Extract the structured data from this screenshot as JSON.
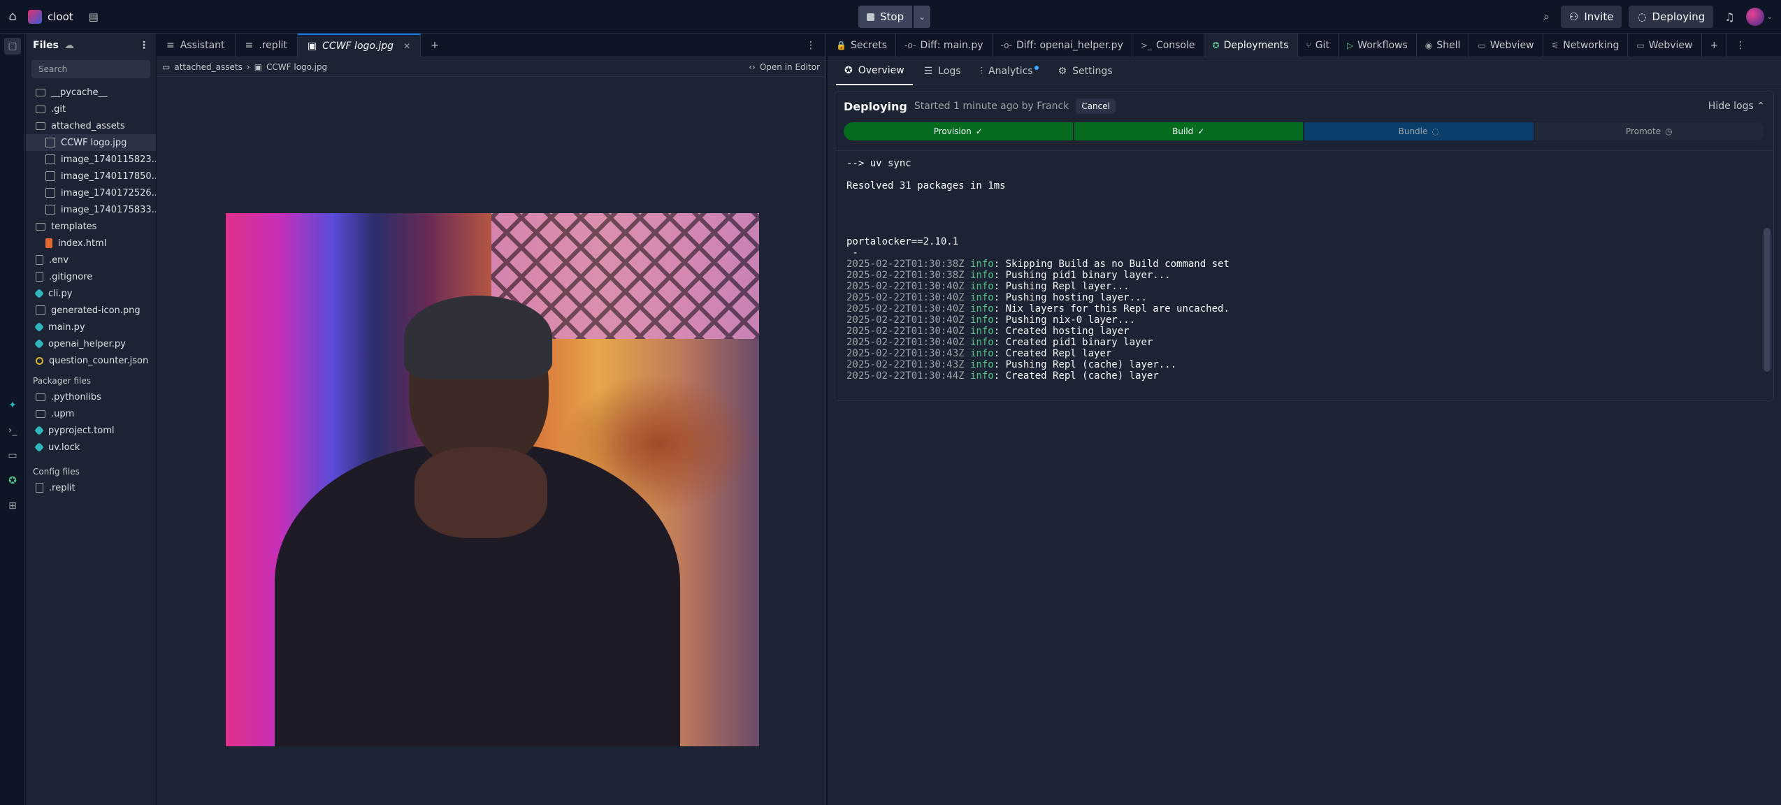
{
  "topbar": {
    "project": "cloot",
    "stop_label": "Stop",
    "invite_label": "Invite",
    "deploying_label": "Deploying"
  },
  "files": {
    "title": "Files",
    "search_placeholder": "Search",
    "tree": [
      {
        "name": "__pycache__",
        "type": "folder",
        "depth": 0
      },
      {
        "name": ".git",
        "type": "folder",
        "depth": 0
      },
      {
        "name": "attached_assets",
        "type": "folder",
        "depth": 0
      },
      {
        "name": "CCWF logo.jpg",
        "type": "img",
        "depth": 1,
        "selected": true
      },
      {
        "name": "image_1740115823...",
        "type": "img",
        "depth": 1
      },
      {
        "name": "image_1740117850...",
        "type": "img",
        "depth": 1
      },
      {
        "name": "image_1740172526...",
        "type": "img",
        "depth": 1
      },
      {
        "name": "image_1740175833...",
        "type": "img",
        "depth": 1
      },
      {
        "name": "templates",
        "type": "folder",
        "depth": 0
      },
      {
        "name": "index.html",
        "type": "html",
        "depth": 1
      },
      {
        "name": ".env",
        "type": "file",
        "depth": 0
      },
      {
        "name": ".gitignore",
        "type": "file",
        "depth": 0
      },
      {
        "name": "cli.py",
        "type": "py",
        "depth": 0
      },
      {
        "name": "generated-icon.png",
        "type": "img",
        "depth": 0
      },
      {
        "name": "main.py",
        "type": "py",
        "depth": 0
      },
      {
        "name": "openai_helper.py",
        "type": "py",
        "depth": 0
      },
      {
        "name": "question_counter.json",
        "type": "json",
        "depth": 0
      }
    ],
    "packager_label": "Packager files",
    "packager": [
      {
        "name": ".pythonlibs",
        "type": "folder"
      },
      {
        "name": ".upm",
        "type": "folder"
      },
      {
        "name": "pyproject.toml",
        "type": "toml"
      },
      {
        "name": "uv.lock",
        "type": "toml"
      }
    ],
    "config_label": "Config files",
    "config": [
      {
        "name": ".replit",
        "type": "file"
      }
    ]
  },
  "editor": {
    "tabs": [
      {
        "label": "Assistant",
        "icon": "assistant-icon"
      },
      {
        "label": ".replit",
        "icon": "replit-icon"
      },
      {
        "label": "CCWF logo.jpg",
        "icon": "image-icon",
        "active": true
      }
    ],
    "breadcrumb": [
      "attached_assets",
      "CCWF logo.jpg"
    ],
    "open_in_editor": "Open in Editor"
  },
  "right": {
    "tabs": [
      {
        "label": "Secrets",
        "icon": "lock-icon"
      },
      {
        "label": "Diff: main.py",
        "icon": "diff-icon"
      },
      {
        "label": "Diff: openai_helper.py",
        "icon": "diff-icon"
      },
      {
        "label": "Console",
        "icon": "console-icon"
      },
      {
        "label": "Deployments",
        "icon": "deploy-icon",
        "active": true
      },
      {
        "label": "Git",
        "icon": "git-icon"
      },
      {
        "label": "Workflows",
        "icon": "play-icon"
      },
      {
        "label": "Shell",
        "icon": "shell-icon"
      },
      {
        "label": "Webview",
        "icon": "monitor-icon"
      },
      {
        "label": "Networking",
        "icon": "network-icon"
      },
      {
        "label": "Webview",
        "icon": "monitor-icon"
      }
    ],
    "subtabs": [
      "Overview",
      "Logs",
      "Analytics",
      "Settings"
    ],
    "deploy": {
      "title": "Deploying",
      "subtitle": "Started 1 minute ago by Franck",
      "cancel": "Cancel",
      "hide_logs": "Hide logs",
      "steps": [
        {
          "label": "Provision",
          "state": "done"
        },
        {
          "label": "Build",
          "state": "done"
        },
        {
          "label": "Bundle",
          "state": "running"
        },
        {
          "label": "Promote",
          "state": "pending"
        }
      ],
      "log_lines": [
        {
          "text": "--> uv sync"
        },
        {
          "text": ""
        },
        {
          "text": "Resolved 31 packages in 1ms"
        },
        {
          "text": ""
        },
        {
          "text": ""
        },
        {
          "text": ""
        },
        {
          "text": ""
        },
        {
          "text": "portalocker==2.10.1"
        },
        {
          "text": " -"
        },
        {
          "ts": "2025-02-22T01:30:38Z",
          "lvl": "info",
          "msg": ": Skipping Build as no Build command set"
        },
        {
          "ts": "2025-02-22T01:30:38Z",
          "lvl": "info",
          "msg": ": Pushing pid1 binary layer..."
        },
        {
          "ts": "2025-02-22T01:30:40Z",
          "lvl": "info",
          "msg": ": Pushing Repl layer..."
        },
        {
          "ts": "2025-02-22T01:30:40Z",
          "lvl": "info",
          "msg": ": Pushing hosting layer..."
        },
        {
          "ts": "2025-02-22T01:30:40Z",
          "lvl": "info",
          "msg": ": Nix layers for this Repl are uncached."
        },
        {
          "ts": "2025-02-22T01:30:40Z",
          "lvl": "info",
          "msg": ": Pushing nix-0 layer..."
        },
        {
          "ts": "2025-02-22T01:30:40Z",
          "lvl": "info",
          "msg": ": Created hosting layer"
        },
        {
          "ts": "2025-02-22T01:30:40Z",
          "lvl": "info",
          "msg": ": Created pid1 binary layer"
        },
        {
          "ts": "2025-02-22T01:30:43Z",
          "lvl": "info",
          "msg": ": Created Repl layer"
        },
        {
          "ts": "2025-02-22T01:30:43Z",
          "lvl": "info",
          "msg": ": Pushing Repl (cache) layer..."
        },
        {
          "ts": "2025-02-22T01:30:44Z",
          "lvl": "info",
          "msg": ": Created Repl (cache) layer"
        }
      ]
    }
  }
}
